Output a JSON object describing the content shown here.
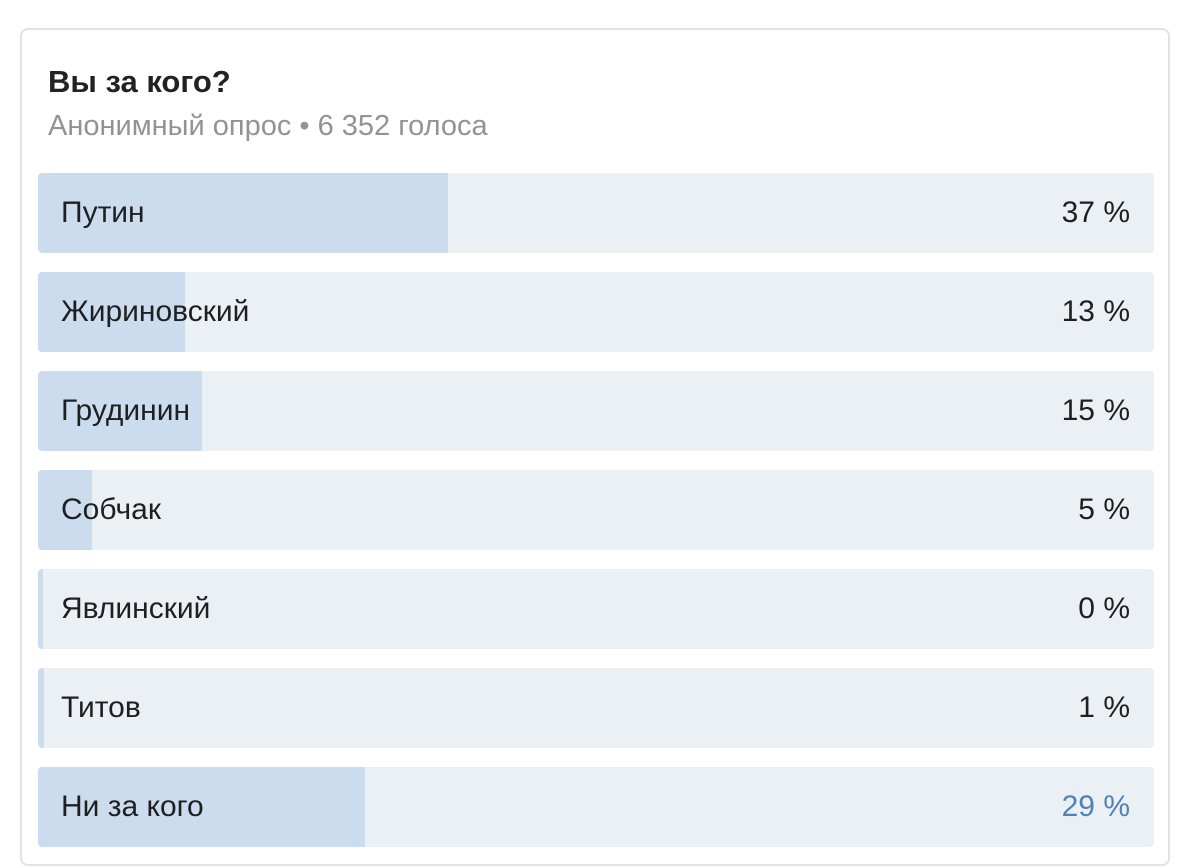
{
  "poll": {
    "question": "Вы за кого?",
    "meta": "Анонимный опрос • 6 352 голоса",
    "accent_color": "#5181b8",
    "bar_fill_color": "#ccdcef",
    "bar_bg_color": "#ebf0f5",
    "options": [
      {
        "label": "Путин",
        "percent_text": "37 %",
        "share": 0.367
      },
      {
        "label": "Жириновский",
        "percent_text": "13 %",
        "share": 0.132
      },
      {
        "label": "Грудинин",
        "percent_text": "15 %",
        "share": 0.147
      },
      {
        "label": "Собчак",
        "percent_text": "5 %",
        "share": 0.048
      },
      {
        "label": "Явлинский",
        "percent_text": "0 %",
        "share": 0.0
      },
      {
        "label": "Титов",
        "percent_text": "1 %",
        "share": 0.005
      },
      {
        "label": "Ни за кого",
        "percent_text": "29 %",
        "share": 0.293,
        "voted": true
      }
    ]
  }
}
